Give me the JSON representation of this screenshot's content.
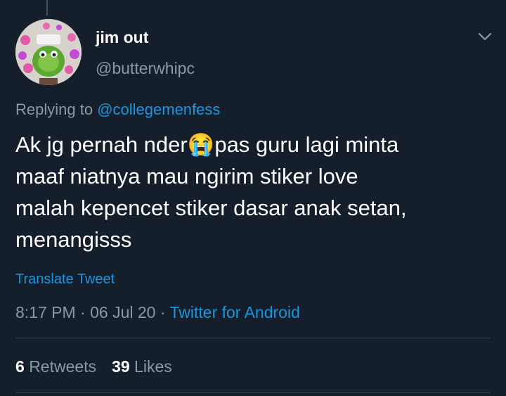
{
  "author": {
    "display_name": "jim out",
    "handle": "@butterwhipc",
    "avatar_icon": "avatar-photo"
  },
  "menu": {
    "icon": "chevron-down-icon"
  },
  "reply": {
    "prefix": "Replying to ",
    "mention": "@collegemenfess"
  },
  "tweet": {
    "text_before_emoji": "Ak jg pernah nder",
    "emoji": "😭",
    "text_after_emoji": "pas guru lagi minta\nmaaf niatnya mau ngirim stiker love\nmalah kepencet stiker dasar anak setan,\nmenangisss"
  },
  "translate_label": "Translate Tweet",
  "meta": {
    "time": "8:17 PM",
    "separator": " · ",
    "date": "06 Jul 20",
    "source": "Twitter for Android"
  },
  "stats": {
    "retweets_count": "6",
    "retweets_label": "Retweets",
    "likes_count": "39",
    "likes_label": "Likes"
  },
  "colors": {
    "background": "#151f2b",
    "text": "#ffffff",
    "secondary": "#8899a6",
    "link": "#1b95e0",
    "divider": "#38444d"
  }
}
